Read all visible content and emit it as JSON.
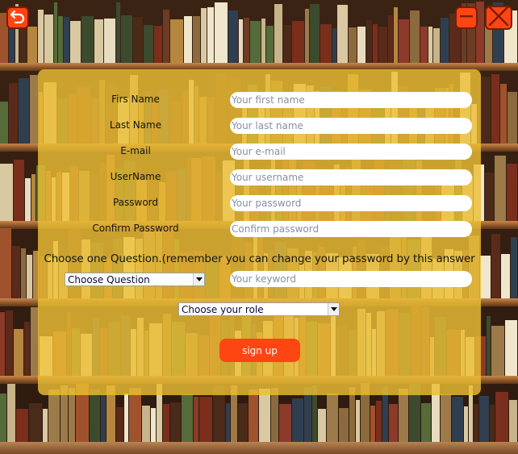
{
  "window": {
    "back_icon": "back-arrow-icon",
    "minimize_icon": "minimize-icon",
    "close_icon": "close-icon",
    "accent": "#ff4512"
  },
  "form": {
    "fields": [
      {
        "label": "Firs Name",
        "placeholder": "Your first name",
        "value": ""
      },
      {
        "label": "Last Name",
        "placeholder": "Your last name",
        "value": ""
      },
      {
        "label": "E-mail",
        "placeholder": "Your e-mail",
        "value": ""
      },
      {
        "label": "UserName",
        "placeholder": "Your username",
        "value": ""
      },
      {
        "label": "Password",
        "placeholder": "Your password",
        "value": ""
      },
      {
        "label": "Confirm Password",
        "placeholder": "Confirm password",
        "value": ""
      }
    ],
    "question_prompt": "Choose one Question.(remember you can change your password by this answer",
    "question_select": "Choose Question",
    "keyword_placeholder": "Your keyword",
    "role_select": "Choose your role",
    "signup_label": "sign up",
    "panel_color": "#ebbe34"
  }
}
